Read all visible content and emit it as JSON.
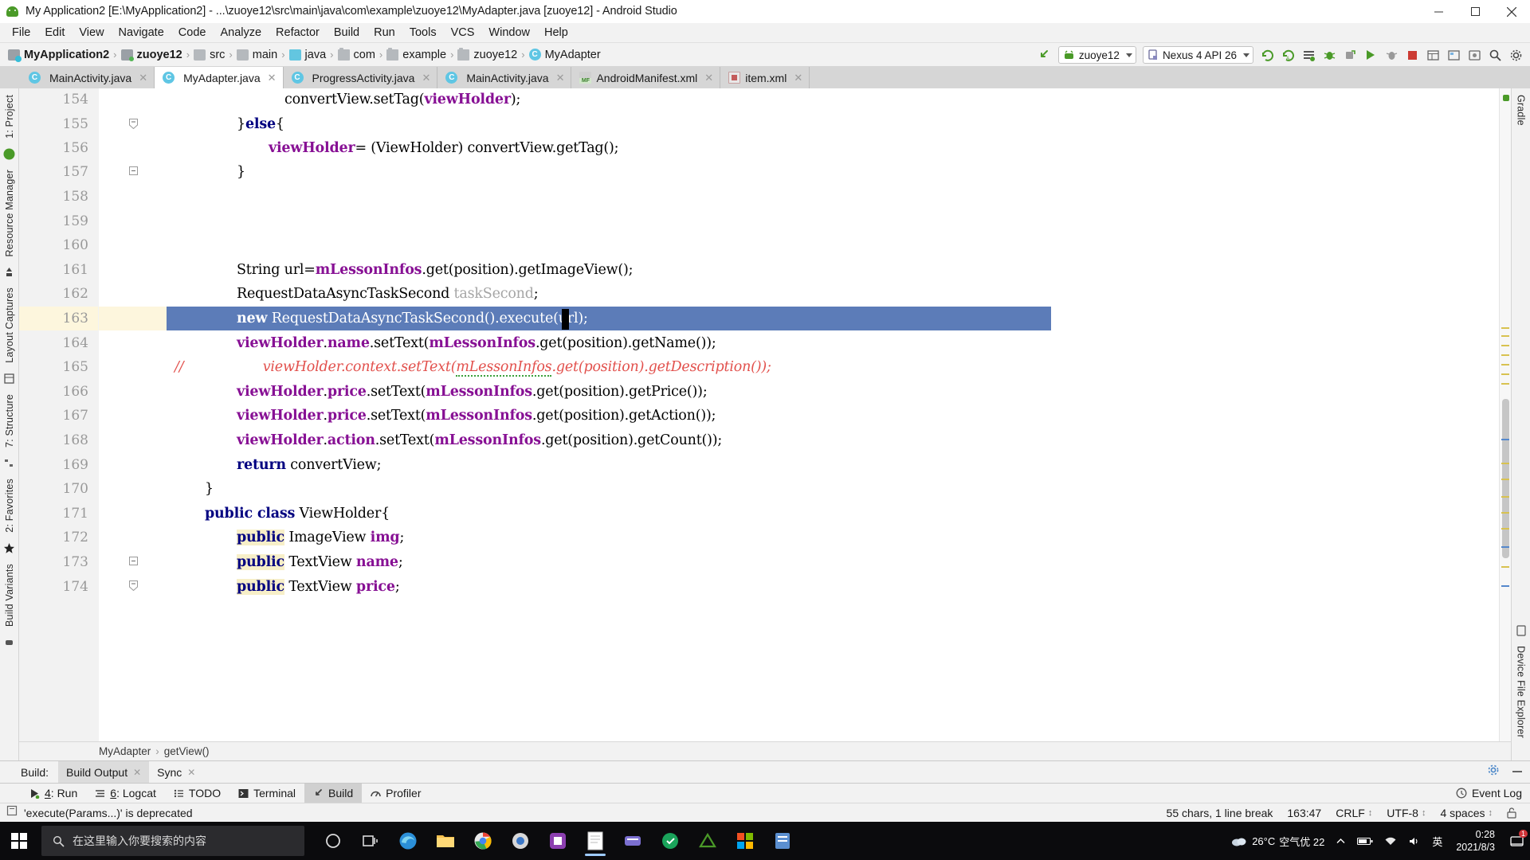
{
  "window": {
    "title": "My Application2 [E:\\MyApplication2] - ...\\zuoye12\\src\\main\\java\\com\\example\\zuoye12\\MyAdapter.java [zuoye12] - Android Studio",
    "app_icon": "android-studio-icon",
    "minimize_glyph": "–",
    "maximize_glyph": "❐",
    "close_glyph": "✕"
  },
  "menubar": {
    "items": [
      {
        "label": "File"
      },
      {
        "label": "Edit"
      },
      {
        "label": "View"
      },
      {
        "label": "Navigate"
      },
      {
        "label": "Code"
      },
      {
        "label": "Analyze"
      },
      {
        "label": "Refactor"
      },
      {
        "label": "Build"
      },
      {
        "label": "Run"
      },
      {
        "label": "Tools"
      },
      {
        "label": "VCS"
      },
      {
        "label": "Window"
      },
      {
        "label": "Help"
      }
    ]
  },
  "navbar": {
    "breadcrumbs": [
      {
        "label": "MyApplication2",
        "icon": "app-module-icon",
        "bold": true
      },
      {
        "label": "zuoye12",
        "icon": "module-icon",
        "bold": true
      },
      {
        "label": "src",
        "icon": "folder-icon",
        "bold": false
      },
      {
        "label": "main",
        "icon": "folder-icon",
        "bold": false
      },
      {
        "label": "java",
        "icon": "java-folder-icon",
        "bold": false
      },
      {
        "label": "com",
        "icon": "package-icon",
        "bold": false
      },
      {
        "label": "example",
        "icon": "package-icon",
        "bold": false
      },
      {
        "label": "zuoye12",
        "icon": "package-icon",
        "bold": false
      },
      {
        "label": "MyAdapter",
        "icon": "class-icon",
        "bold": false
      }
    ],
    "separator": "›",
    "run_config": {
      "label": "zuoye12",
      "icon": "android-icon"
    },
    "device": {
      "label": "Nexus 4 API 26",
      "icon": "device-icon"
    },
    "toolbar_icons": [
      "sync-project-icon",
      "avd-manager-icon",
      "sdk-manager-icon",
      "run-button",
      "debug-button",
      "run-coverage-icon",
      "profiler-icon",
      "attach-debugger-icon",
      "stop-button",
      "layout-inspector-icon",
      "device-file-explorer-icon",
      "search-icon"
    ]
  },
  "editor_tabs": [
    {
      "label": "MainActivity.java",
      "icon": "java-class-icon",
      "active": false,
      "close": "✕"
    },
    {
      "label": "MyAdapter.java",
      "icon": "java-class-icon",
      "active": true,
      "close": "✕"
    },
    {
      "label": "ProgressActivity.java",
      "icon": "java-class-icon",
      "active": false,
      "close": "✕"
    },
    {
      "label": "MainActivity.java",
      "icon": "java-class-icon",
      "active": false,
      "close": "✕"
    },
    {
      "label": "AndroidManifest.xml",
      "icon": "manifest-icon",
      "active": false,
      "close": "✕"
    },
    {
      "label": "item.xml",
      "icon": "xml-resource-icon",
      "active": false,
      "close": "✕"
    }
  ],
  "left_rail": [
    {
      "label": "1: Project"
    },
    {
      "label": "Resource Manager"
    },
    {
      "label": "Layout Captures"
    },
    {
      "label": "7: Structure"
    },
    {
      "label": "2: Favorites"
    },
    {
      "label": "Build Variants"
    }
  ],
  "right_rail": [
    {
      "label": "Gradle"
    },
    {
      "label": "Device File Explorer"
    }
  ],
  "editor": {
    "file": "MyAdapter.java",
    "first_line": 154,
    "selected_line": 163,
    "caret_column_char": 13,
    "lines": [
      {
        "n": 154,
        "indent": 8,
        "tokens": [
          {
            "t": "convertView",
            "c": "lvar"
          },
          {
            "t": ".",
            "c": "lvar"
          },
          {
            "t": "setTag",
            "c": "lvar"
          },
          {
            "t": "(",
            "c": "lvar"
          },
          {
            "t": "viewHolder",
            "c": "fldb"
          },
          {
            "t": ");",
            "c": "lvar"
          }
        ]
      },
      {
        "n": 155,
        "indent": 4,
        "fold": "collapse-end",
        "tokens": [
          {
            "t": "}",
            "c": "lvar"
          },
          {
            "t": "else",
            "c": "kw"
          },
          {
            "t": "{",
            "c": "lvar"
          }
        ]
      },
      {
        "n": 156,
        "indent": 6,
        "tokens": [
          {
            "t": "viewHolder",
            "c": "fldb"
          },
          {
            "t": "= (ViewHolder) convertView.getTag();",
            "c": "lvar"
          }
        ]
      },
      {
        "n": 157,
        "indent": 4,
        "fold": "collapse-close",
        "tokens": [
          {
            "t": "}",
            "c": "lvar"
          }
        ]
      },
      {
        "n": 158,
        "indent": 0,
        "tokens": []
      },
      {
        "n": 159,
        "indent": 0,
        "tokens": []
      },
      {
        "n": 160,
        "indent": 0,
        "tokens": []
      },
      {
        "n": 161,
        "indent": 4,
        "tokens": [
          {
            "t": "String url=",
            "c": "lvar"
          },
          {
            "t": "mLessonInfos",
            "c": "fldb"
          },
          {
            "t": ".get(position).getImageView();",
            "c": "lvar"
          }
        ]
      },
      {
        "n": 162,
        "indent": 4,
        "tokens": [
          {
            "t": "RequestDataAsyncTaskSecond ",
            "c": "lvar"
          },
          {
            "t": "taskSecond",
            "c": "unused"
          },
          {
            "t": ";",
            "c": "lvar"
          }
        ]
      },
      {
        "n": 163,
        "indent": 4,
        "selected": true,
        "tokens": [
          {
            "t": "new",
            "c": "kw"
          },
          {
            "t": " RequestDataAsyncTaskSecond().execute(url);",
            "c": "lvar"
          }
        ]
      },
      {
        "n": 164,
        "indent": 4,
        "tokens": [
          {
            "t": "viewHolder",
            "c": "fldb"
          },
          {
            "t": ".",
            "c": "lvar"
          },
          {
            "t": "name",
            "c": "fldb"
          },
          {
            "t": ".setText(",
            "c": "lvar"
          },
          {
            "t": "mLessonInfos",
            "c": "fldb"
          },
          {
            "t": ".get(position).getName());",
            "c": "lvar"
          }
        ]
      },
      {
        "n": 165,
        "indent": 5,
        "comment_marker": "//",
        "tokens": [
          {
            "t": "viewHolder.context.setText(mLessonInfos.get(position).getDescription());",
            "c": "cmt"
          }
        ]
      },
      {
        "n": 166,
        "indent": 4,
        "tokens": [
          {
            "t": "viewHolder",
            "c": "fldb"
          },
          {
            "t": ".",
            "c": "lvar"
          },
          {
            "t": "price",
            "c": "fldb"
          },
          {
            "t": ".setText(",
            "c": "lvar"
          },
          {
            "t": "mLessonInfos",
            "c": "fldb"
          },
          {
            "t": ".get(position).getPrice());",
            "c": "lvar"
          }
        ]
      },
      {
        "n": 167,
        "indent": 4,
        "tokens": [
          {
            "t": "viewHolder",
            "c": "fldb"
          },
          {
            "t": ".",
            "c": "lvar"
          },
          {
            "t": "price",
            "c": "fldb"
          },
          {
            "t": ".setText(",
            "c": "lvar"
          },
          {
            "t": "mLessonInfos",
            "c": "fldb"
          },
          {
            "t": ".get(position).getAction());",
            "c": "lvar"
          }
        ]
      },
      {
        "n": 168,
        "indent": 4,
        "tokens": [
          {
            "t": "viewHolder",
            "c": "fldb"
          },
          {
            "t": ".",
            "c": "lvar"
          },
          {
            "t": "action",
            "c": "fldb"
          },
          {
            "t": ".setText(",
            "c": "lvar"
          },
          {
            "t": "mLessonInfos",
            "c": "fldb"
          },
          {
            "t": ".get(position).getCount());",
            "c": "lvar"
          }
        ]
      },
      {
        "n": 169,
        "indent": 4,
        "tokens": [
          {
            "t": "return",
            "c": "kw"
          },
          {
            "t": " convertView;",
            "c": "lvar"
          }
        ]
      },
      {
        "n": 170,
        "indent": 2,
        "fold": "collapse-close",
        "tokens": [
          {
            "t": "}",
            "c": "lvar"
          }
        ]
      },
      {
        "n": 171,
        "indent": 2,
        "fold": "collapse-start",
        "tokens": [
          {
            "t": "public class",
            "c": "kw"
          },
          {
            "t": " ViewHolder{",
            "c": "lvar"
          }
        ]
      },
      {
        "n": 172,
        "indent": 4,
        "tokens": [
          {
            "t": "public",
            "c": "kw hl"
          },
          {
            "t": " ImageView ",
            "c": "lvar"
          },
          {
            "t": "img",
            "c": "fldb"
          },
          {
            "t": ";",
            "c": "lvar"
          }
        ]
      },
      {
        "n": 173,
        "indent": 4,
        "tokens": [
          {
            "t": "public",
            "c": "kw hl"
          },
          {
            "t": " TextView ",
            "c": "lvar"
          },
          {
            "t": "name",
            "c": "fldb"
          },
          {
            "t": ";",
            "c": "lvar"
          }
        ]
      },
      {
        "n": 174,
        "indent": 4,
        "tokens": [
          {
            "t": "public",
            "c": "kw hl"
          },
          {
            "t": " TextView ",
            "c": "lvar"
          },
          {
            "t": "price",
            "c": "fldb"
          },
          {
            "t": ";",
            "c": "lvar"
          }
        ]
      }
    ]
  },
  "method_breadcrumb": {
    "class": "MyAdapter",
    "separator": "›",
    "method": "getView()"
  },
  "build_panel": {
    "label": "Build:",
    "tabs": [
      {
        "label": "Build Output",
        "active": true,
        "close": "✕"
      },
      {
        "label": "Sync",
        "active": false,
        "close": "✕"
      }
    ],
    "settings_icon": "gear-icon",
    "minimize_icon": "minimize-icon"
  },
  "bottom_tabs": [
    {
      "key": "4",
      "label": ": Run",
      "icon": "run-icon",
      "active": false
    },
    {
      "key": "6",
      "label": ": Logcat",
      "icon": "logcat-icon",
      "active": false
    },
    {
      "key": "",
      "label": "TODO",
      "icon": "todo-icon",
      "active": false
    },
    {
      "key": "",
      "label": "Terminal",
      "icon": "terminal-icon",
      "active": false
    },
    {
      "key": "",
      "label": "Build",
      "icon": "build-hammer-icon",
      "active": true
    },
    {
      "key": "",
      "label": "Profiler",
      "icon": "profiler-icon",
      "active": false
    }
  ],
  "event_log": {
    "label": "Event Log",
    "icon": "event-log-icon"
  },
  "statusbar": {
    "message": "'execute(Params...)' is deprecated",
    "message_icon": "info-icon",
    "chars": "55 chars, 1 line break",
    "position": "163:47",
    "line_sep": "CRLF",
    "encoding": "UTF-8",
    "indent": "4 spaces",
    "lock_icon": "unlocked-icon",
    "caret_glyph": "↕"
  },
  "taskbar": {
    "search_placeholder": "在这里输入你要搜索的内容",
    "search_icon": "search-icon",
    "start_icon": "windows-logo",
    "pinned": [
      {
        "name": "cortana-icon"
      },
      {
        "name": "task-view-icon"
      },
      {
        "name": "edge-icon"
      },
      {
        "name": "file-explorer-icon"
      },
      {
        "name": "chrome-icon"
      },
      {
        "name": "browser-icon"
      },
      {
        "name": "app-icon-1"
      },
      {
        "name": "notepad-icon"
      },
      {
        "name": "app-icon-2"
      },
      {
        "name": "app-icon-3"
      },
      {
        "name": "android-studio-icon"
      },
      {
        "name": "app-icon-4"
      },
      {
        "name": "app-icon-5"
      }
    ],
    "weather": {
      "temp": "26°C",
      "label": "空气优 22",
      "icon": "cloud-icon"
    },
    "tray_icons": [
      "chevron-up-icon",
      "battery-icon",
      "network-icon",
      "volume-icon"
    ],
    "ime": "英",
    "time": "0:28",
    "date": "2021/8/3",
    "notification_icon": "notification-icon",
    "notification_count": "1"
  },
  "colors": {
    "accent_blue": "#5c7cb8",
    "keyword": "#000080",
    "field": "#871094",
    "comment_red": "#e2504c",
    "unused_gray": "#a5a5a5",
    "highlight_yellow": "#f7efc8",
    "current_line": "#fdf6dd",
    "green": "#4a9a28"
  }
}
